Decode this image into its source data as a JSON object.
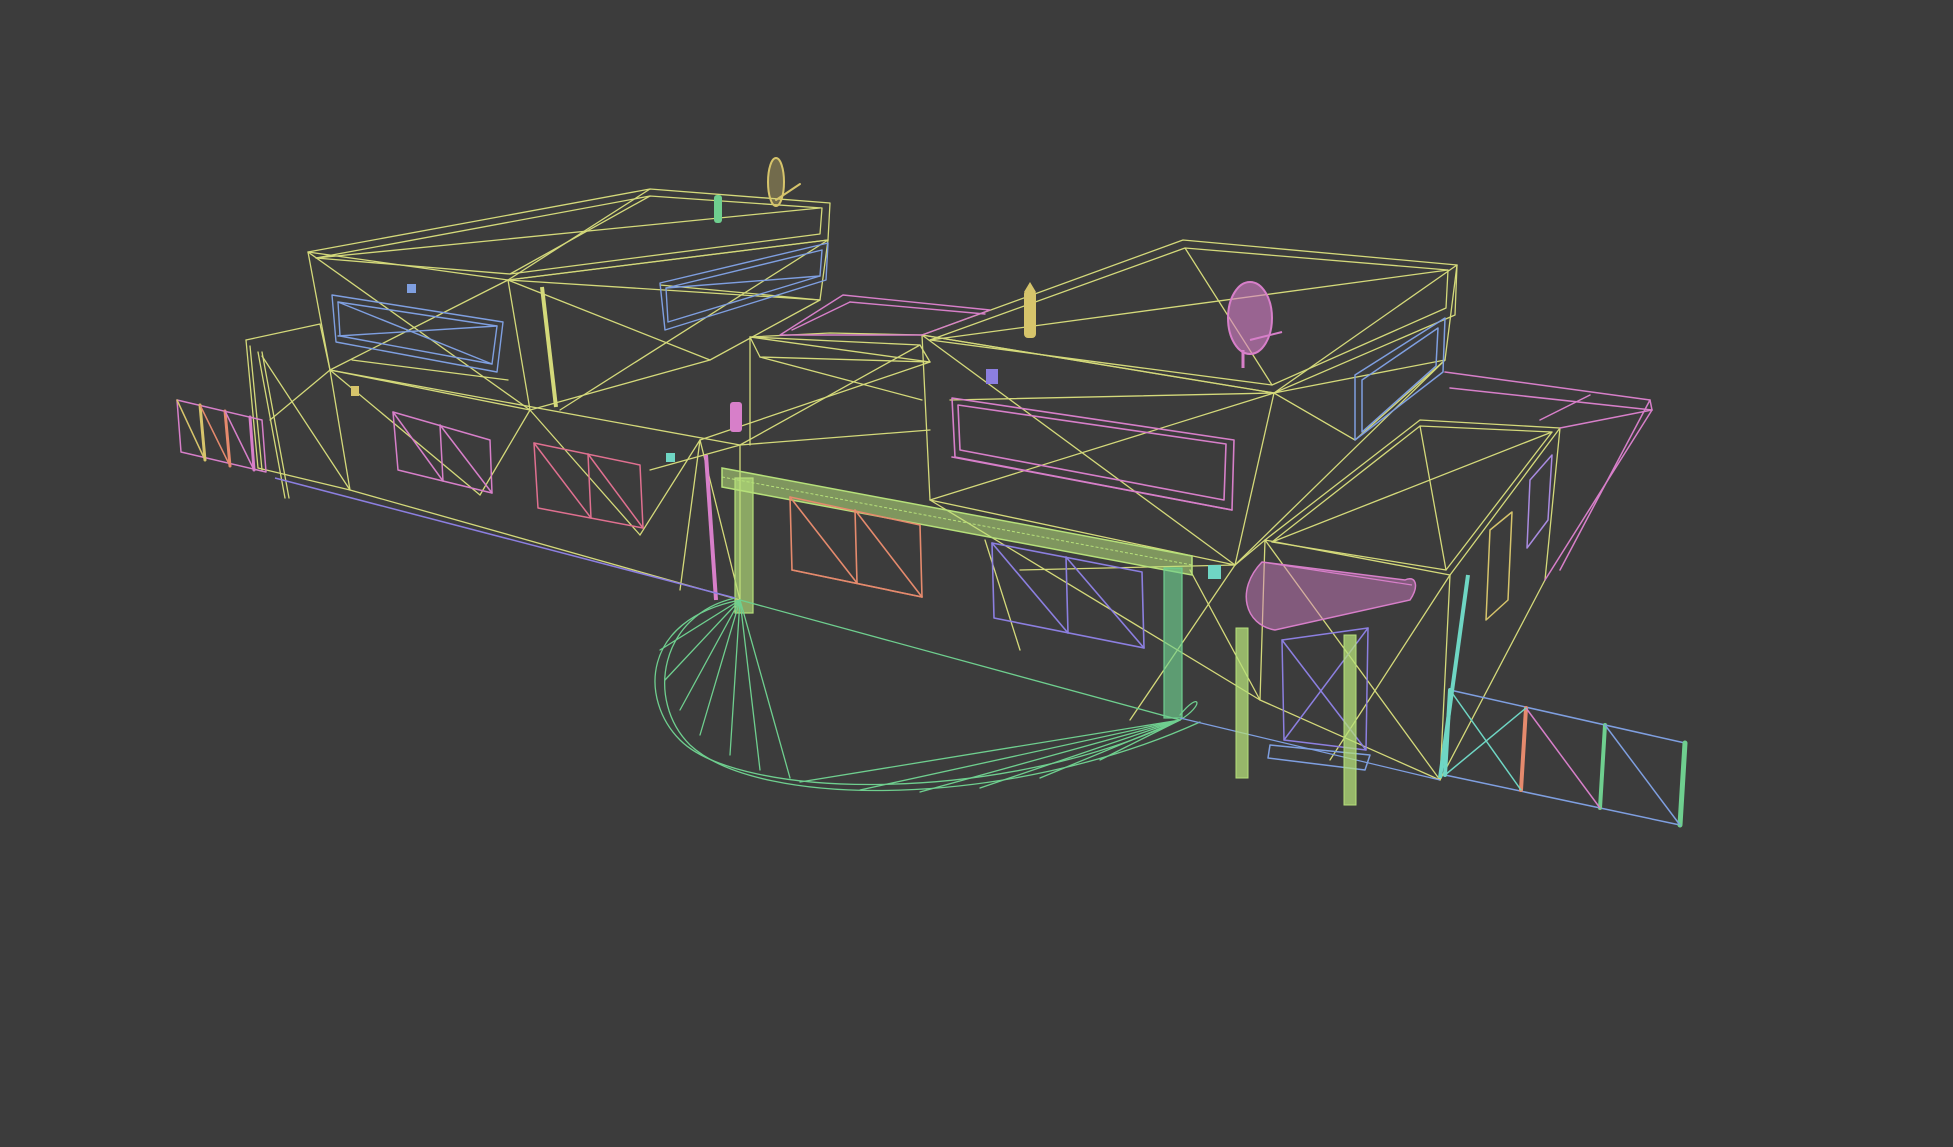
{
  "viewport": {
    "background": "#3c3c3c",
    "render_mode": "wireframe"
  },
  "palette": {
    "yellow": "#d4d97a",
    "blue": "#7f9fe0",
    "pink": "#d77fc9",
    "green": "#6fcf8f",
    "light_green": "#b6e07a",
    "salmon": "#e58a6d",
    "violet": "#8c7fe0",
    "teal": "#6fd6c4",
    "gold": "#d6c46b",
    "red_pink": "#e07090"
  }
}
